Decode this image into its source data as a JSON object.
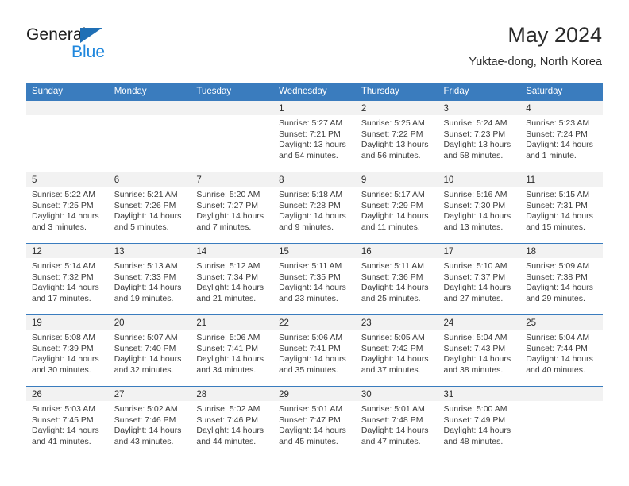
{
  "brand": {
    "name_line1": "General",
    "name_line2": "Blue",
    "triangle_color": "#1f6fb5",
    "blue_text_color": "#1f87dd"
  },
  "header": {
    "title": "May 2024",
    "subtitle": "Yuktae-dong, North Korea"
  },
  "theme": {
    "header_row_bg": "#3a7cbe",
    "header_row_text": "#ffffff",
    "daynum_strip_bg": "#f2f2f2",
    "row_divider": "#3a7cbe",
    "body_text": "#3c3c3c"
  },
  "weekdays": [
    "Sunday",
    "Monday",
    "Tuesday",
    "Wednesday",
    "Thursday",
    "Friday",
    "Saturday"
  ],
  "labels": {
    "sunrise": "Sunrise:",
    "sunset": "Sunset:",
    "daylight": "Daylight:"
  },
  "weeks": [
    [
      {
        "day": "",
        "empty": true
      },
      {
        "day": "",
        "empty": true
      },
      {
        "day": "",
        "empty": true
      },
      {
        "day": "1",
        "sunrise": "Sunrise: 5:27 AM",
        "sunset": "Sunset: 7:21 PM",
        "daylight1": "Daylight: 13 hours",
        "daylight2": "and 54 minutes."
      },
      {
        "day": "2",
        "sunrise": "Sunrise: 5:25 AM",
        "sunset": "Sunset: 7:22 PM",
        "daylight1": "Daylight: 13 hours",
        "daylight2": "and 56 minutes."
      },
      {
        "day": "3",
        "sunrise": "Sunrise: 5:24 AM",
        "sunset": "Sunset: 7:23 PM",
        "daylight1": "Daylight: 13 hours",
        "daylight2": "and 58 minutes."
      },
      {
        "day": "4",
        "sunrise": "Sunrise: 5:23 AM",
        "sunset": "Sunset: 7:24 PM",
        "daylight1": "Daylight: 14 hours",
        "daylight2": "and 1 minute."
      }
    ],
    [
      {
        "day": "5",
        "sunrise": "Sunrise: 5:22 AM",
        "sunset": "Sunset: 7:25 PM",
        "daylight1": "Daylight: 14 hours",
        "daylight2": "and 3 minutes."
      },
      {
        "day": "6",
        "sunrise": "Sunrise: 5:21 AM",
        "sunset": "Sunset: 7:26 PM",
        "daylight1": "Daylight: 14 hours",
        "daylight2": "and 5 minutes."
      },
      {
        "day": "7",
        "sunrise": "Sunrise: 5:20 AM",
        "sunset": "Sunset: 7:27 PM",
        "daylight1": "Daylight: 14 hours",
        "daylight2": "and 7 minutes."
      },
      {
        "day": "8",
        "sunrise": "Sunrise: 5:18 AM",
        "sunset": "Sunset: 7:28 PM",
        "daylight1": "Daylight: 14 hours",
        "daylight2": "and 9 minutes."
      },
      {
        "day": "9",
        "sunrise": "Sunrise: 5:17 AM",
        "sunset": "Sunset: 7:29 PM",
        "daylight1": "Daylight: 14 hours",
        "daylight2": "and 11 minutes."
      },
      {
        "day": "10",
        "sunrise": "Sunrise: 5:16 AM",
        "sunset": "Sunset: 7:30 PM",
        "daylight1": "Daylight: 14 hours",
        "daylight2": "and 13 minutes."
      },
      {
        "day": "11",
        "sunrise": "Sunrise: 5:15 AM",
        "sunset": "Sunset: 7:31 PM",
        "daylight1": "Daylight: 14 hours",
        "daylight2": "and 15 minutes."
      }
    ],
    [
      {
        "day": "12",
        "sunrise": "Sunrise: 5:14 AM",
        "sunset": "Sunset: 7:32 PM",
        "daylight1": "Daylight: 14 hours",
        "daylight2": "and 17 minutes."
      },
      {
        "day": "13",
        "sunrise": "Sunrise: 5:13 AM",
        "sunset": "Sunset: 7:33 PM",
        "daylight1": "Daylight: 14 hours",
        "daylight2": "and 19 minutes."
      },
      {
        "day": "14",
        "sunrise": "Sunrise: 5:12 AM",
        "sunset": "Sunset: 7:34 PM",
        "daylight1": "Daylight: 14 hours",
        "daylight2": "and 21 minutes."
      },
      {
        "day": "15",
        "sunrise": "Sunrise: 5:11 AM",
        "sunset": "Sunset: 7:35 PM",
        "daylight1": "Daylight: 14 hours",
        "daylight2": "and 23 minutes."
      },
      {
        "day": "16",
        "sunrise": "Sunrise: 5:11 AM",
        "sunset": "Sunset: 7:36 PM",
        "daylight1": "Daylight: 14 hours",
        "daylight2": "and 25 minutes."
      },
      {
        "day": "17",
        "sunrise": "Sunrise: 5:10 AM",
        "sunset": "Sunset: 7:37 PM",
        "daylight1": "Daylight: 14 hours",
        "daylight2": "and 27 minutes."
      },
      {
        "day": "18",
        "sunrise": "Sunrise: 5:09 AM",
        "sunset": "Sunset: 7:38 PM",
        "daylight1": "Daylight: 14 hours",
        "daylight2": "and 29 minutes."
      }
    ],
    [
      {
        "day": "19",
        "sunrise": "Sunrise: 5:08 AM",
        "sunset": "Sunset: 7:39 PM",
        "daylight1": "Daylight: 14 hours",
        "daylight2": "and 30 minutes."
      },
      {
        "day": "20",
        "sunrise": "Sunrise: 5:07 AM",
        "sunset": "Sunset: 7:40 PM",
        "daylight1": "Daylight: 14 hours",
        "daylight2": "and 32 minutes."
      },
      {
        "day": "21",
        "sunrise": "Sunrise: 5:06 AM",
        "sunset": "Sunset: 7:41 PM",
        "daylight1": "Daylight: 14 hours",
        "daylight2": "and 34 minutes."
      },
      {
        "day": "22",
        "sunrise": "Sunrise: 5:06 AM",
        "sunset": "Sunset: 7:41 PM",
        "daylight1": "Daylight: 14 hours",
        "daylight2": "and 35 minutes."
      },
      {
        "day": "23",
        "sunrise": "Sunrise: 5:05 AM",
        "sunset": "Sunset: 7:42 PM",
        "daylight1": "Daylight: 14 hours",
        "daylight2": "and 37 minutes."
      },
      {
        "day": "24",
        "sunrise": "Sunrise: 5:04 AM",
        "sunset": "Sunset: 7:43 PM",
        "daylight1": "Daylight: 14 hours",
        "daylight2": "and 38 minutes."
      },
      {
        "day": "25",
        "sunrise": "Sunrise: 5:04 AM",
        "sunset": "Sunset: 7:44 PM",
        "daylight1": "Daylight: 14 hours",
        "daylight2": "and 40 minutes."
      }
    ],
    [
      {
        "day": "26",
        "sunrise": "Sunrise: 5:03 AM",
        "sunset": "Sunset: 7:45 PM",
        "daylight1": "Daylight: 14 hours",
        "daylight2": "and 41 minutes."
      },
      {
        "day": "27",
        "sunrise": "Sunrise: 5:02 AM",
        "sunset": "Sunset: 7:46 PM",
        "daylight1": "Daylight: 14 hours",
        "daylight2": "and 43 minutes."
      },
      {
        "day": "28",
        "sunrise": "Sunrise: 5:02 AM",
        "sunset": "Sunset: 7:46 PM",
        "daylight1": "Daylight: 14 hours",
        "daylight2": "and 44 minutes."
      },
      {
        "day": "29",
        "sunrise": "Sunrise: 5:01 AM",
        "sunset": "Sunset: 7:47 PM",
        "daylight1": "Daylight: 14 hours",
        "daylight2": "and 45 minutes."
      },
      {
        "day": "30",
        "sunrise": "Sunrise: 5:01 AM",
        "sunset": "Sunset: 7:48 PM",
        "daylight1": "Daylight: 14 hours",
        "daylight2": "and 47 minutes."
      },
      {
        "day": "31",
        "sunrise": "Sunrise: 5:00 AM",
        "sunset": "Sunset: 7:49 PM",
        "daylight1": "Daylight: 14 hours",
        "daylight2": "and 48 minutes."
      },
      {
        "day": "",
        "empty": true
      }
    ]
  ]
}
